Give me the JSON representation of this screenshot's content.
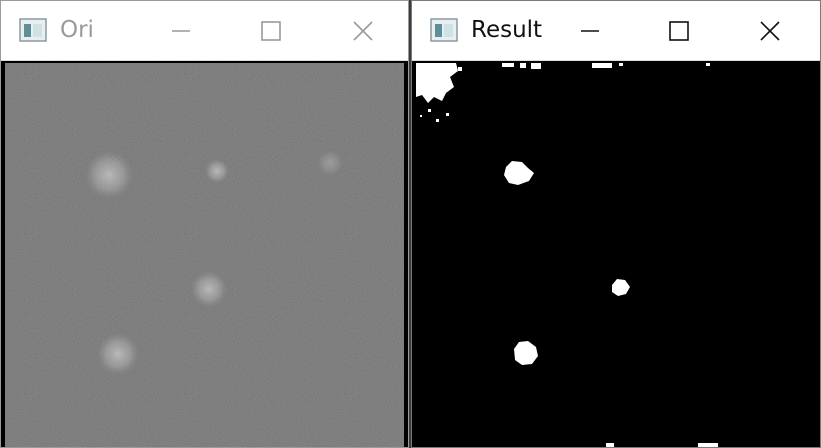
{
  "windows": {
    "ori": {
      "title": "Ori",
      "active": false,
      "controls": {
        "minimize": "minimize-icon",
        "maximize": "maximize-icon",
        "close": "close-icon"
      }
    },
    "result": {
      "title": "Result",
      "active": true,
      "controls": {
        "minimize": "minimize-icon",
        "maximize": "maximize-icon",
        "close": "close-icon"
      }
    }
  },
  "colors": {
    "inactive_title": "#9a9a9a",
    "active_title": "#111111",
    "ori_background": "#6a6a6a",
    "result_background": "#000000",
    "blob": "#ffffff"
  }
}
